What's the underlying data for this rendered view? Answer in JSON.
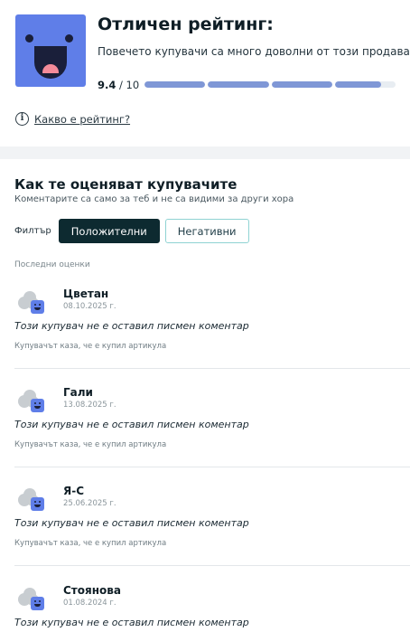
{
  "rating": {
    "title": "Отличен рейтинг:",
    "description": "Повечето купувачи са много доволни от този продавач",
    "score": "9.4",
    "score_max": "/ 10",
    "score_fraction": 0.94,
    "bar_segments": 4,
    "bar_fill_color": "#7f97d6",
    "face_color": "#5f7ee8"
  },
  "info_link": {
    "label": "Какво е рейтинг?",
    "icon": "info-icon"
  },
  "buyers_section": {
    "title": "Как те оценяват купувачите",
    "subtitle": "Коментарите са само за теб и не са видими за други хора",
    "filter_label": "Филтър",
    "filters": [
      {
        "label": "Положителни",
        "active": true
      },
      {
        "label": "Негативни",
        "active": false
      }
    ],
    "recent_label": "Последни оценки"
  },
  "reviews": [
    {
      "name": "Цветан",
      "date": "08.10.2025 г.",
      "comment": "Този купувач не е оставил писмен коментар",
      "bought": "Купувачът каза, че е купил артикула"
    },
    {
      "name": "Гали",
      "date": "13.08.2025 г.",
      "comment": "Този купувач не е оставил писмен коментар",
      "bought": "Купувачът каза, че е купил артикула"
    },
    {
      "name": "Я-С",
      "date": "25.06.2025 г.",
      "comment": "Този купувач не е оставил писмен коментар",
      "bought": "Купувачът каза, че е купил артикула"
    },
    {
      "name": "Стоянова",
      "date": "01.08.2024 г.",
      "comment": "Този купувач не е оставил писмен коментар",
      "bought": ""
    }
  ]
}
